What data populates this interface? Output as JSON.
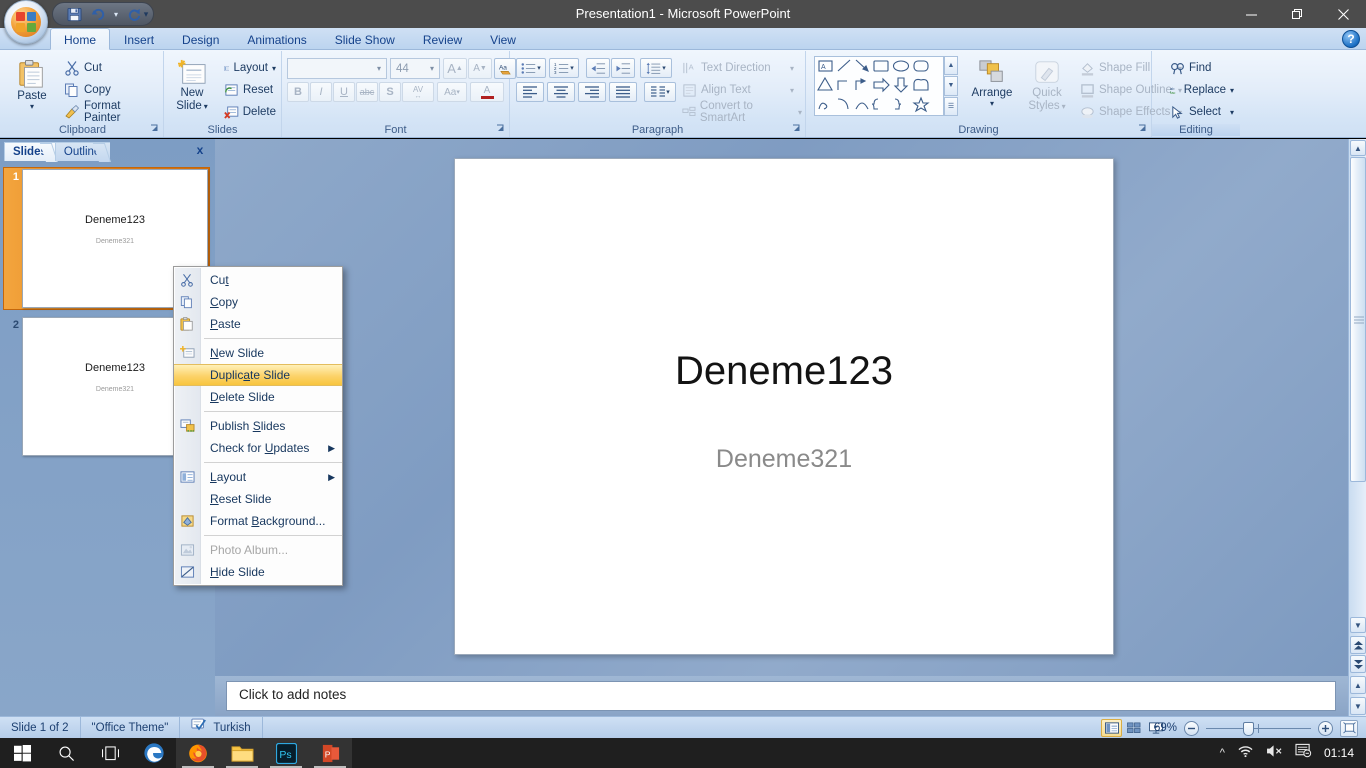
{
  "window": {
    "title": "Presentation1  -  Microsoft PowerPoint",
    "minimize": "—",
    "restore": "❐",
    "close": "✕"
  },
  "qat": {
    "save": "save-icon",
    "undo": "undo-icon",
    "undo_dropdown": "▾",
    "redo": "redo-icon",
    "customize": "▾"
  },
  "ribbon": {
    "tabs": [
      {
        "label": "Home",
        "active": true
      },
      {
        "label": "Insert",
        "active": false
      },
      {
        "label": "Design",
        "active": false
      },
      {
        "label": "Animations",
        "active": false
      },
      {
        "label": "Slide Show",
        "active": false
      },
      {
        "label": "Review",
        "active": false
      },
      {
        "label": "View",
        "active": false
      }
    ],
    "help": "?",
    "groups": {
      "clipboard": {
        "title": "Clipboard",
        "paste": "Paste",
        "paste_arrow": "▾",
        "cut": "Cut",
        "copy": "Copy",
        "format_painter": "Format Painter",
        "launcher": "↘"
      },
      "slides": {
        "title": "Slides",
        "new_slide": "New\nSlide",
        "new_slide_line1": "New",
        "new_slide_line2": "Slide",
        "new_slide_arrow": "▾",
        "layout": "Layout",
        "layout_arrow": "▾",
        "reset": "Reset",
        "delete": "Delete"
      },
      "font": {
        "title": "Font",
        "font_name": "",
        "font_name_placeholder": "",
        "font_size": "44",
        "grow_font": "A",
        "shrink_font": "A",
        "clear_formatting": "Aa",
        "bold": "B",
        "italic": "I",
        "underline": "U",
        "strikethrough": "abc",
        "shadow": "S",
        "character_spacing": "AV",
        "change_case": "Aa",
        "font_color": "A",
        "launcher": "↘"
      },
      "paragraph": {
        "title": "Paragraph",
        "bullets": "bullets-icon",
        "numbering": "numbering-icon",
        "decrease_indent": "decrease-indent-icon",
        "increase_indent": "increase-indent-icon",
        "line_spacing": "line-spacing-icon",
        "align_left": "align-left-icon",
        "align_center": "align-center-icon",
        "align_right": "align-right-icon",
        "justify": "justify-icon",
        "columns": "columns-icon",
        "text_direction": "Text Direction",
        "align_text": "Align Text",
        "convert_smartart": "Convert to SmartArt",
        "launcher": "↘"
      },
      "drawing": {
        "title": "Drawing",
        "arrange": "Arrange",
        "arrange_arrow": "▾",
        "quick_styles_line1": "Quick",
        "quick_styles_line2": "Styles",
        "quick_styles_arrow": "▾",
        "shape_fill": "Shape Fill",
        "shape_outline": "Shape Outline",
        "shape_effects": "Shape Effects",
        "launcher": "↘"
      },
      "editing": {
        "title": "Editing",
        "find": "Find",
        "replace": "Replace",
        "select": "Select"
      }
    }
  },
  "left_pane": {
    "tab_slides": "Slides",
    "tab_outline": "Outline",
    "close": "x",
    "thumbnails": [
      {
        "number": "1",
        "title": "Deneme123",
        "subtitle": "Deneme321",
        "selected": true
      },
      {
        "number": "2",
        "title": "Deneme123",
        "subtitle": "Deneme321",
        "selected": false
      }
    ]
  },
  "slide": {
    "title": "Deneme123",
    "subtitle": "Deneme321"
  },
  "notes": {
    "placeholder": "Click to add notes"
  },
  "context_menu": {
    "items": [
      {
        "label": "Cut",
        "icon": "cut-icon",
        "accel_index": 2,
        "type": "item"
      },
      {
        "label": "Copy",
        "icon": "copy-icon",
        "accel_index": 0,
        "type": "item"
      },
      {
        "label": "Paste",
        "icon": "paste-icon",
        "accel_index": 0,
        "type": "item"
      },
      {
        "type": "separator"
      },
      {
        "label": "New Slide",
        "icon": "new-slide-icon",
        "accel_index": 1,
        "type": "item"
      },
      {
        "label": "Duplicate Slide",
        "icon": "",
        "accel_index": 8,
        "type": "item",
        "selected": true
      },
      {
        "label": "Delete Slide",
        "icon": "",
        "accel_index": 0,
        "type": "item"
      },
      {
        "type": "separator"
      },
      {
        "label": "Publish Slides",
        "icon": "publish-slides-icon",
        "accel_index": 8,
        "type": "item"
      },
      {
        "label": "Check for Updates",
        "icon": "",
        "accel_index": 10,
        "type": "item",
        "submenu": true
      },
      {
        "type": "separator"
      },
      {
        "label": "Layout",
        "icon": "layout-icon",
        "accel_index": 0,
        "type": "item",
        "submenu": true
      },
      {
        "label": "Reset Slide",
        "icon": "",
        "accel_index": 0,
        "type": "item"
      },
      {
        "label": "Format Background...",
        "icon": "format-background-icon",
        "accel_index": 7,
        "type": "item"
      },
      {
        "type": "separator"
      },
      {
        "label": "Photo Album...",
        "icon": "photo-album-icon",
        "accel_index": -1,
        "type": "item",
        "disabled": true
      },
      {
        "label": "Hide Slide",
        "icon": "hide-slide-icon",
        "accel_index": 0,
        "type": "item"
      }
    ]
  },
  "status_bar": {
    "slide_count": "Slide 1 of 2",
    "theme": "\"Office Theme\"",
    "language": "Turkish",
    "spell_icon": "spellcheck-icon",
    "view_normal": "normal-view-icon",
    "view_sorter": "slide-sorter-icon",
    "view_slideshow": "slideshow-view-icon",
    "zoom_percent": "69%",
    "zoom_out": "−",
    "zoom_in": "+",
    "fit_window": "fit-to-window-icon"
  },
  "taskbar": {
    "start": "start-icon",
    "search": "search-icon",
    "task_view": "task-view-icon",
    "apps": [
      {
        "name": "edge-icon",
        "running": false
      },
      {
        "name": "firefox-icon",
        "running": true
      },
      {
        "name": "file-explorer-icon",
        "running": true
      },
      {
        "name": "photoshop-icon",
        "running": true
      },
      {
        "name": "powerpoint-icon",
        "running": true
      }
    ],
    "tray_expand": "∧",
    "tray_wifi": "wifi-icon",
    "tray_volume": "volume-muted-icon",
    "tray_action_center": "action-center-icon",
    "clock": "01:14"
  },
  "colors": {
    "accent_orange": "#e07c16",
    "ribbon_blue": "#cfe0f4",
    "menu_highlight": "#fcd36a",
    "titlebar": "#4c4c4c"
  }
}
